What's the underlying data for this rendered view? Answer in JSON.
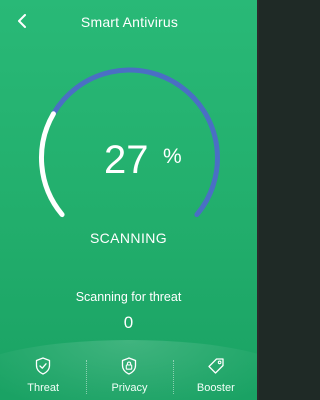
{
  "header": {
    "title": "Smart Antivirus",
    "back_icon": "chevron-left-icon"
  },
  "scan": {
    "progress_percent": 27,
    "percent_value": "27",
    "percent_sign": "%",
    "status": "SCANNING",
    "label": "Scanning for threat",
    "threat_count": "0"
  },
  "nav": {
    "items": [
      {
        "label": "Threat",
        "icon": "shield-check-icon"
      },
      {
        "label": "Privacy",
        "icon": "shield-lock-icon"
      },
      {
        "label": "Booster",
        "icon": "tag-icon"
      }
    ]
  },
  "colors": {
    "background_top": "#29b977",
    "background_bottom": "#1aa264",
    "gauge_progress": "#ffffff",
    "gauge_track": "#4a6fc4",
    "text": "#ffffff"
  }
}
